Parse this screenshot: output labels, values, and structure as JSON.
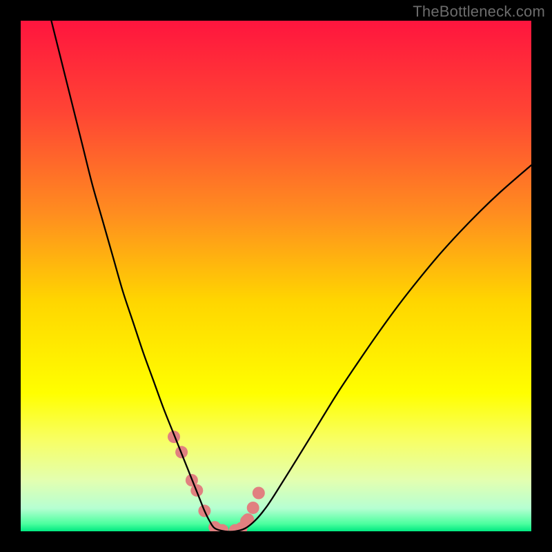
{
  "watermark": "TheBottleneck.com",
  "chart_data": {
    "type": "line",
    "title": "",
    "xlabel": "",
    "ylabel": "",
    "xlim": [
      0,
      100
    ],
    "ylim": [
      0,
      100
    ],
    "grid": false,
    "legend": false,
    "gradient_stops": [
      {
        "offset": 0,
        "color": "#ff153e"
      },
      {
        "offset": 0.18,
        "color": "#ff4534"
      },
      {
        "offset": 0.38,
        "color": "#ff8e1f"
      },
      {
        "offset": 0.55,
        "color": "#ffd600"
      },
      {
        "offset": 0.73,
        "color": "#ffff00"
      },
      {
        "offset": 0.82,
        "color": "#f8ff63"
      },
      {
        "offset": 0.9,
        "color": "#e3ffb0"
      },
      {
        "offset": 0.955,
        "color": "#b6ffd2"
      },
      {
        "offset": 0.985,
        "color": "#4dff9f"
      },
      {
        "offset": 1.0,
        "color": "#00e981"
      }
    ],
    "series": [
      {
        "name": "bottleneck-curve",
        "color": "#000000",
        "width": 2.3,
        "x": [
          6,
          8,
          10,
          12,
          14,
          16,
          18,
          20,
          22,
          24,
          26,
          28,
          30,
          31,
          32,
          33,
          34,
          35,
          36,
          37,
          38,
          40,
          42,
          44,
          46,
          48,
          50,
          54,
          58,
          62,
          66,
          70,
          74,
          78,
          82,
          86,
          90,
          94,
          98,
          100
        ],
        "y": [
          100,
          92,
          84,
          76,
          68,
          61,
          54,
          47,
          41,
          35,
          29.5,
          24,
          19,
          16.5,
          14,
          11.5,
          9,
          6.5,
          4,
          2,
          0.6,
          0,
          0,
          0.6,
          2.2,
          4.6,
          7.6,
          14,
          20.5,
          27,
          33,
          38.8,
          44.3,
          49.4,
          54.2,
          58.6,
          62.7,
          66.5,
          70,
          71.7
        ]
      }
    ],
    "markers": {
      "name": "bottleneck-markers",
      "color": "#e18080",
      "radius": 9,
      "x": [
        30.0,
        31.5,
        33.5,
        34.5,
        36.0,
        38.0,
        38.5,
        39.5,
        42.0,
        43.2,
        44.2,
        44.5,
        45.5,
        46.6
      ],
      "y": [
        18.5,
        15.5,
        10.0,
        8.0,
        4.0,
        0.8,
        0.4,
        0.2,
        0.2,
        0.6,
        2.0,
        2.3,
        4.6,
        7.5
      ]
    }
  }
}
